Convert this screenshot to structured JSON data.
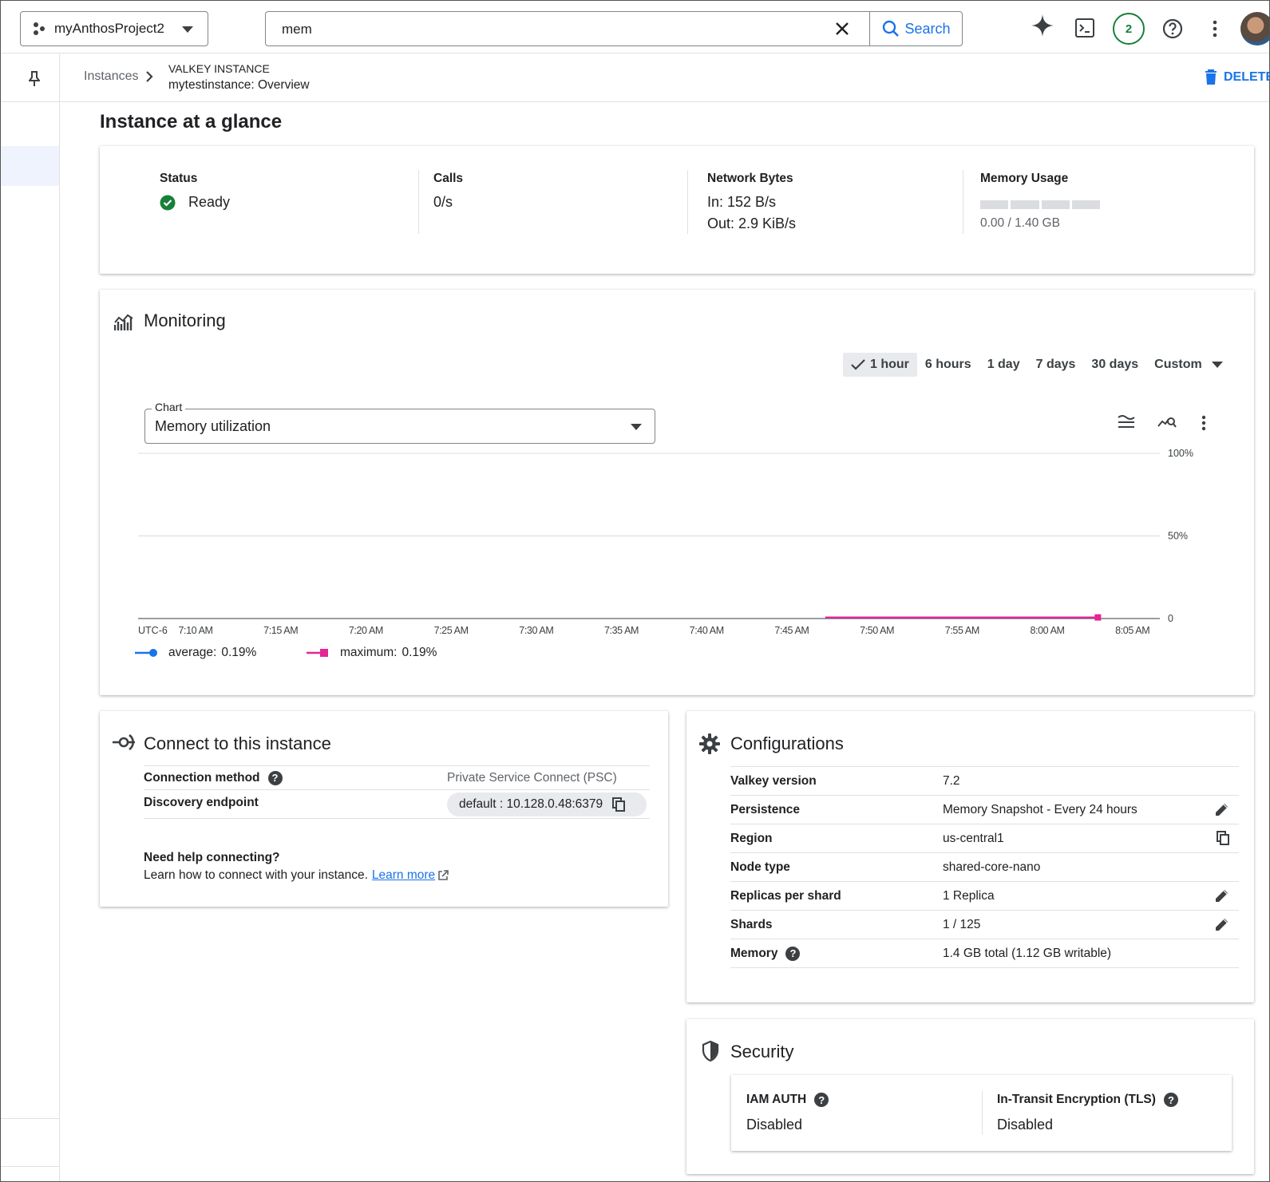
{
  "topbar": {
    "project": "myAnthosProject2",
    "search_value": "mem",
    "search_button": "Search",
    "notifications": "2"
  },
  "breadcrumb": {
    "parent": "Instances",
    "type": "VALKEY INSTANCE",
    "page": "mytestinstance: Overview",
    "delete_label": "DELETE"
  },
  "glance": {
    "title": "Instance at a glance",
    "status_label": "Status",
    "status_value": "Ready",
    "calls_label": "Calls",
    "calls_value": "0/s",
    "network_label": "Network Bytes",
    "network_in": "In: 152 B/s",
    "network_out": "Out: 2.9 KiB/s",
    "memory_label": "Memory Usage",
    "memory_value": "0.00 / 1.40 GB",
    "memory_fraction": 0.0
  },
  "monitoring": {
    "title": "Monitoring",
    "time_options": [
      "1 hour",
      "6 hours",
      "1 day",
      "7 days",
      "30 days",
      "Custom"
    ],
    "selected_time": "1 hour",
    "chart_select_label": "Chart",
    "chart_select_value": "Memory utilization"
  },
  "chart_data": {
    "type": "line",
    "title": "",
    "xlabel": "",
    "ylabel": "",
    "timezone": "UTC-6",
    "x_ticks": [
      "7:10 AM",
      "7:15 AM",
      "7:20 AM",
      "7:25 AM",
      "7:30 AM",
      "7:35 AM",
      "7:40 AM",
      "7:45 AM",
      "7:50 AM",
      "7:55 AM",
      "8:00 AM",
      "8:05 AM"
    ],
    "y_ticks": [
      "100%",
      "50%",
      "0"
    ],
    "ylim": [
      0,
      100
    ],
    "series": [
      {
        "name": "average",
        "legend": "average:",
        "legend_value": "0.19%",
        "color": "#1a73e8",
        "x": [
          "7:48 AM",
          "8:04 AM"
        ],
        "y": [
          0.19,
          0.19
        ]
      },
      {
        "name": "maximum",
        "legend": "maximum:",
        "legend_value": "0.19%",
        "color": "#e52592",
        "x": [
          "7:48 AM",
          "8:04 AM"
        ],
        "y": [
          0.19,
          0.19
        ]
      }
    ],
    "grid": true
  },
  "connect": {
    "title": "Connect to this instance",
    "method_label": "Connection method",
    "method_value": "Private Service Connect (PSC)",
    "endpoint_label": "Discovery endpoint",
    "endpoint_value": "default : 10.128.0.48:6379",
    "help_title": "Need help connecting?",
    "help_text": "Learn how to connect with your instance.",
    "learn_more": "Learn more"
  },
  "config": {
    "title": "Configurations",
    "rows": [
      {
        "label": "Valkey version",
        "value": "7.2",
        "icon": ""
      },
      {
        "label": "Persistence",
        "value": "Memory Snapshot - Every 24 hours",
        "icon": "edit-icon"
      },
      {
        "label": "Region",
        "value": "us-central1",
        "icon": "copy-icon"
      },
      {
        "label": "Node type",
        "value": "shared-core-nano",
        "icon": ""
      },
      {
        "label": "Replicas per shard",
        "value": "1 Replica",
        "icon": "edit-icon"
      },
      {
        "label": "Shards",
        "value": "1 / 125",
        "icon": "edit-icon"
      },
      {
        "label": "Memory",
        "value": "1.4 GB total (1.12 GB writable)",
        "icon": "help-icon"
      }
    ]
  },
  "security": {
    "title": "Security",
    "iam_label": "IAM AUTH",
    "iam_value": "Disabled",
    "tls_label": "In-Transit Encryption (TLS)",
    "tls_value": "Disabled"
  },
  "colors": {
    "accent": "#1a73e8",
    "ready": "#188038",
    "maximum": "#e52592"
  }
}
